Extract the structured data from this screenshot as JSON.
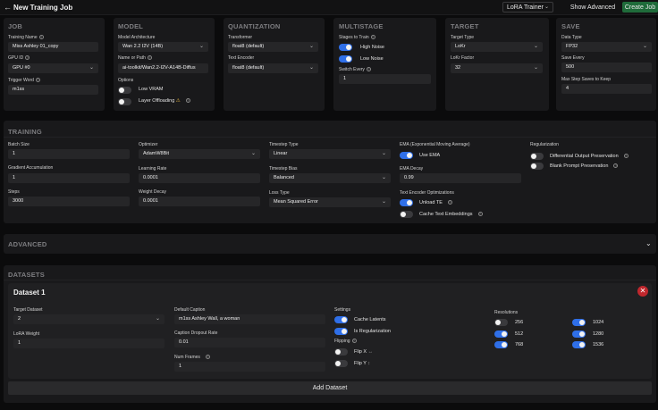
{
  "header": {
    "title": "New Training Job",
    "trainer_select": "LoRA Trainer",
    "show_advanced": "Show Advanced",
    "create_job": "Create Job"
  },
  "job": {
    "title": "JOB",
    "training_name_label": "Training Name",
    "training_name": "Miss Ashley 01_copy",
    "gpu_label": "GPU ID",
    "gpu": "GPU #0",
    "trigger_label": "Trigger Word",
    "trigger": "m1ss"
  },
  "model": {
    "title": "MODEL",
    "arch_label": "Model Architecture",
    "arch": "Wan 2.2 I2V (14B)",
    "path_label": "Name or Path",
    "path": "ai-toolkit/Wan2.2-I2V-A14B-Diffus",
    "options_label": "Options",
    "low_vram": "Low VRAM",
    "layer_offloading": "Layer Offloading",
    "warn": "⚠"
  },
  "quantization": {
    "title": "QUANTIZATION",
    "transformer_label": "Transformer",
    "transformer": "float8 (default)",
    "text_encoder_label": "Text Encoder",
    "text_encoder": "float8 (default)"
  },
  "multistage": {
    "title": "MULTISTAGE",
    "stages_label": "Stages to Train",
    "high_noise": "High Noise",
    "low_noise": "Low Noise",
    "switch_label": "Switch Every",
    "switch": "1"
  },
  "target": {
    "title": "TARGET",
    "type_label": "Target Type",
    "type": "LoKr",
    "factor_label": "LoKr Factor",
    "factor": "32"
  },
  "save": {
    "title": "SAVE",
    "dtype_label": "Data Type",
    "dtype": "FP32",
    "every_label": "Save Every",
    "every": "500",
    "max_label": "Max Step Saves to Keep",
    "max": "4"
  },
  "training": {
    "title": "TRAINING",
    "batch_label": "Batch Size",
    "batch": "1",
    "grad_label": "Gradient Accumulation",
    "grad": "1",
    "steps_label": "Steps",
    "steps": "3000",
    "optimizer_label": "Optimizer",
    "optimizer": "AdamW8Bit",
    "lr_label": "Learning Rate",
    "lr": "0.0001",
    "wd_label": "Weight Decay",
    "wd": "0.0001",
    "ts_type_label": "Timestep Type",
    "ts_type": "Linear",
    "ts_bias_label": "Timestep Bias",
    "ts_bias": "Balanced",
    "loss_label": "Loss Type",
    "loss": "Mean Squared Error",
    "ema_label": "EMA (Exponential Moving Average)",
    "use_ema": "Use EMA",
    "ema_decay_label": "EMA Decay",
    "ema_decay": "0.99",
    "te_opt_label": "Text Encoder Optimizations",
    "unload_te": "Unload TE",
    "cache_te": "Cache Text Embeddings",
    "reg_label": "Regularization",
    "diff_output": "Differential Output Preservation",
    "blank_prompt": "Blank Prompt Preservation"
  },
  "advanced": {
    "title": "ADVANCED"
  },
  "datasets": {
    "title": "DATASETS",
    "dataset_title": "Dataset 1",
    "target_label": "Target Dataset",
    "target": "2",
    "lora_weight_label": "LoRA Weight",
    "lora_weight": "1",
    "caption_label": "Default Caption",
    "caption": "m1ss Ashley Wall, a woman",
    "dropout_label": "Caption Dropout Rate",
    "dropout": "0.01",
    "frames_label": "Num Frames",
    "frames": "1",
    "settings_label": "Settings",
    "cache_latents": "Cache Latents",
    "is_reg": "Is Regularization",
    "flipping_label": "Flipping",
    "flip_x": "Flip X",
    "flip_x_sym": "↔",
    "flip_y": "Flip Y",
    "flip_y_sym": "↕",
    "res_label": "Resolutions",
    "res": [
      "256",
      "512",
      "768",
      "1024",
      "1280",
      "1536"
    ],
    "add_dataset": "Add Dataset"
  },
  "colors": {
    "accent": "#2f6fe8",
    "create": "#1f6b3a",
    "danger": "#c0272d"
  }
}
